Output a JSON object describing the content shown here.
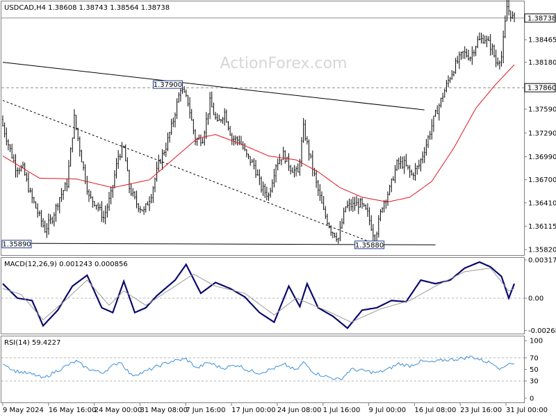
{
  "chart_data": [
    {
      "id": "price",
      "type": "candlestick",
      "header": "USDCAD,H4  1.38608 1.38743 1.38564 1.38738",
      "watermark": "ActionForex.com",
      "x_ticks": [
        "9 May 2024",
        "16 May 16:00",
        "24 May 00:00",
        "31 May 08:00",
        "7 Jun 16:00",
        "17 Jun 00:00",
        "24 Jun 08:00",
        "1 Jul 16:00",
        "9 Jul 00:00",
        "16 Jul 08:00",
        "23 Jul 16:00",
        "31 Jul 00:00"
      ],
      "y_ticks": [
        "1.38465",
        "1.38180",
        "1.37590",
        "1.37290",
        "1.36990",
        "1.36700",
        "1.36410",
        "1.36115",
        "1.35820"
      ],
      "y_range": [
        1.3576,
        1.3893
      ],
      "price_path": [
        [
          0,
          1.3746
        ],
        [
          4,
          1.3715
        ],
        [
          8,
          1.3686
        ],
        [
          12,
          1.3684
        ],
        [
          16,
          1.3652
        ],
        [
          20,
          1.3629
        ],
        [
          24,
          1.3607
        ],
        [
          28,
          1.3622
        ],
        [
          32,
          1.3648
        ],
        [
          36,
          1.3665
        ],
        [
          38,
          1.3706
        ],
        [
          40,
          1.3748
        ],
        [
          44,
          1.3696
        ],
        [
          48,
          1.3648
        ],
        [
          52,
          1.364
        ],
        [
          56,
          1.3622
        ],
        [
          60,
          1.3651
        ],
        [
          64,
          1.37
        ],
        [
          67,
          1.371
        ],
        [
          70,
          1.366
        ],
        [
          74,
          1.364
        ],
        [
          78,
          1.363
        ],
        [
          82,
          1.3652
        ],
        [
          86,
          1.369
        ],
        [
          90,
          1.3712
        ],
        [
          94,
          1.3745
        ],
        [
          98,
          1.3786
        ],
        [
          102,
          1.3768
        ],
        [
          106,
          1.372
        ],
        [
          110,
          1.3722
        ],
        [
          114,
          1.3768
        ],
        [
          118,
          1.374
        ],
        [
          122,
          1.3755
        ],
        [
          126,
          1.3722
        ],
        [
          130,
          1.372
        ],
        [
          134,
          1.37
        ],
        [
          138,
          1.3688
        ],
        [
          142,
          1.366
        ],
        [
          146,
          1.365
        ],
        [
          150,
          1.369
        ],
        [
          154,
          1.3702
        ],
        [
          158,
          1.3685
        ],
        [
          162,
          1.3678
        ],
        [
          165,
          1.3735
        ],
        [
          168,
          1.3705
        ],
        [
          172,
          1.3665
        ],
        [
          176,
          1.363
        ],
        [
          180,
          1.3607
        ],
        [
          184,
          1.3596
        ],
        [
          188,
          1.3636
        ],
        [
          192,
          1.3638
        ],
        [
          196,
          1.364
        ],
        [
          200,
          1.3627
        ],
        [
          204,
          1.3595
        ],
        [
          208,
          1.3638
        ],
        [
          212,
          1.3658
        ],
        [
          216,
          1.369
        ],
        [
          220,
          1.369
        ],
        [
          224,
          1.3676
        ],
        [
          228,
          1.3688
        ],
        [
          232,
          1.3715
        ],
        [
          236,
          1.3746
        ],
        [
          240,
          1.377
        ],
        [
          244,
          1.3795
        ],
        [
          248,
          1.3815
        ],
        [
          252,
          1.383
        ],
        [
          256,
          1.3825
        ],
        [
          260,
          1.3845
        ],
        [
          264,
          1.3848
        ],
        [
          268,
          1.3835
        ],
        [
          270,
          1.3818
        ],
        [
          273,
          1.3825
        ],
        [
          276,
          1.3888
        ],
        [
          279,
          1.3874
        ]
      ],
      "moving_average": [
        [
          0,
          1.37
        ],
        [
          20,
          1.3672
        ],
        [
          40,
          1.3671
        ],
        [
          60,
          1.366
        ],
        [
          80,
          1.367
        ],
        [
          96,
          1.3702
        ],
        [
          106,
          1.3722
        ],
        [
          116,
          1.3727
        ],
        [
          130,
          1.3715
        ],
        [
          145,
          1.37
        ],
        [
          160,
          1.3695
        ],
        [
          172,
          1.368
        ],
        [
          184,
          1.366
        ],
        [
          196,
          1.3648
        ],
        [
          210,
          1.3642
        ],
        [
          222,
          1.3648
        ],
        [
          234,
          1.3668
        ],
        [
          246,
          1.371
        ],
        [
          258,
          1.376
        ],
        [
          268,
          1.3788
        ],
        [
          279,
          1.3815
        ]
      ],
      "bar_count": 280,
      "annotations": [
        {
          "text": "1.37900",
          "bar": 90,
          "price": 1.379
        },
        {
          "text": "1.35890",
          "bar": 0,
          "price": 1.3589
        },
        {
          "text": "1.35880",
          "bar": 200,
          "price": 1.3588
        }
      ],
      "markers": [
        {
          "text": "1.38738",
          "price": 1.38738,
          "style": "solid-line"
        },
        {
          "text": "1.37860",
          "price": 1.3786,
          "style": "dashed-line"
        }
      ],
      "trendlines": [
        {
          "from": [
            0,
            1.3818
          ],
          "to": [
            230,
            1.3758
          ],
          "style": "solid"
        },
        {
          "from": [
            0,
            1.377
          ],
          "to": [
            200,
            1.3592
          ],
          "style": "dashed"
        },
        {
          "from": [
            0,
            1.359
          ],
          "to": [
            236,
            1.3588
          ],
          "style": "solid"
        }
      ]
    },
    {
      "id": "macd",
      "type": "line",
      "header": "MACD(12,26,9) 0.001243 0.000856",
      "y_ticks": [
        "0.003175",
        "0.00",
        "-0.00268"
      ],
      "y_range": [
        -0.00295,
        0.00335
      ],
      "series": [
        {
          "name": "MACD",
          "color": "#0a0a6e",
          "values": [
            [
              0,
              0.0012
            ],
            [
              8,
              0.0
            ],
            [
              16,
              -0.0002
            ],
            [
              22,
              -0.0023
            ],
            [
              30,
              -0.001
            ],
            [
              38,
              0.001
            ],
            [
              46,
              0.0019
            ],
            [
              54,
              -0.0008
            ],
            [
              60,
              -0.0012
            ],
            [
              66,
              0.0014
            ],
            [
              72,
              -0.0012
            ],
            [
              78,
              -0.0008
            ],
            [
              84,
              0.0002
            ],
            [
              94,
              0.0015
            ],
            [
              100,
              0.0028
            ],
            [
              108,
              0.0004
            ],
            [
              116,
              0.0013
            ],
            [
              124,
              0.0008
            ],
            [
              132,
              0.0001
            ],
            [
              140,
              -0.0012
            ],
            [
              148,
              -0.002
            ],
            [
              156,
              0.001
            ],
            [
              162,
              -0.0007
            ],
            [
              166,
              0.0012
            ],
            [
              172,
              -0.0008
            ],
            [
              180,
              -0.0015
            ],
            [
              188,
              -0.0025
            ],
            [
              196,
              -0.001
            ],
            [
              204,
              -0.0008
            ],
            [
              212,
              -0.0002
            ],
            [
              220,
              -0.0003
            ],
            [
              228,
              0.0015
            ],
            [
              236,
              0.0012
            ],
            [
              244,
              0.0015
            ],
            [
              252,
              0.0025
            ],
            [
              260,
              0.003
            ],
            [
              266,
              0.0026
            ],
            [
              272,
              0.0018
            ],
            [
              276,
              0.0
            ],
            [
              279,
              0.0012
            ]
          ]
        },
        {
          "name": "Signal",
          "color": "#999999",
          "values": [
            [
              0,
              0.0008
            ],
            [
              10,
              0.0003
            ],
            [
              22,
              -0.0018
            ],
            [
              34,
              -0.0002
            ],
            [
              46,
              0.0015
            ],
            [
              58,
              -0.0006
            ],
            [
              66,
              0.0006
            ],
            [
              78,
              -0.0006
            ],
            [
              94,
              0.001
            ],
            [
              104,
              0.002
            ],
            [
              116,
              0.001
            ],
            [
              132,
              0.0004
            ],
            [
              148,
              -0.0014
            ],
            [
              160,
              0.0
            ],
            [
              176,
              -0.001
            ],
            [
              190,
              -0.002
            ],
            [
              206,
              -0.0009
            ],
            [
              222,
              -0.0002
            ],
            [
              236,
              0.001
            ],
            [
              252,
              0.0022
            ],
            [
              266,
              0.0025
            ],
            [
              276,
              0.0006
            ],
            [
              279,
              0.0008
            ]
          ]
        }
      ]
    },
    {
      "id": "rsi",
      "type": "line",
      "header": "RSI(14) 59.4227",
      "y_ticks": [
        "100",
        "70",
        "50",
        "30",
        "0"
      ],
      "y_range": [
        0,
        100
      ],
      "levels": [
        70,
        30
      ],
      "series": [
        {
          "name": "RSI",
          "color": "#3b8fd6",
          "values": [
            [
              0,
              62
            ],
            [
              6,
              48
            ],
            [
              12,
              44
            ],
            [
              18,
              40
            ],
            [
              22,
              34
            ],
            [
              28,
              45
            ],
            [
              36,
              58
            ],
            [
              40,
              64
            ],
            [
              46,
              52
            ],
            [
              54,
              44
            ],
            [
              60,
              56
            ],
            [
              64,
              64
            ],
            [
              70,
              40
            ],
            [
              76,
              44
            ],
            [
              84,
              55
            ],
            [
              92,
              64
            ],
            [
              100,
              68
            ],
            [
              106,
              52
            ],
            [
              112,
              62
            ],
            [
              120,
              52
            ],
            [
              128,
              58
            ],
            [
              134,
              48
            ],
            [
              140,
              44
            ],
            [
              146,
              50
            ],
            [
              154,
              58
            ],
            [
              160,
              48
            ],
            [
              164,
              62
            ],
            [
              170,
              44
            ],
            [
              176,
              38
            ],
            [
              184,
              32
            ],
            [
              190,
              50
            ],
            [
              196,
              48
            ],
            [
              204,
              44
            ],
            [
              210,
              50
            ],
            [
              216,
              60
            ],
            [
              222,
              56
            ],
            [
              228,
              64
            ],
            [
              234,
              62
            ],
            [
              240,
              66
            ],
            [
              248,
              68
            ],
            [
              256,
              72
            ],
            [
              262,
              65
            ],
            [
              268,
              60
            ],
            [
              272,
              50
            ],
            [
              276,
              62
            ],
            [
              279,
              59.4
            ]
          ]
        }
      ]
    }
  ]
}
